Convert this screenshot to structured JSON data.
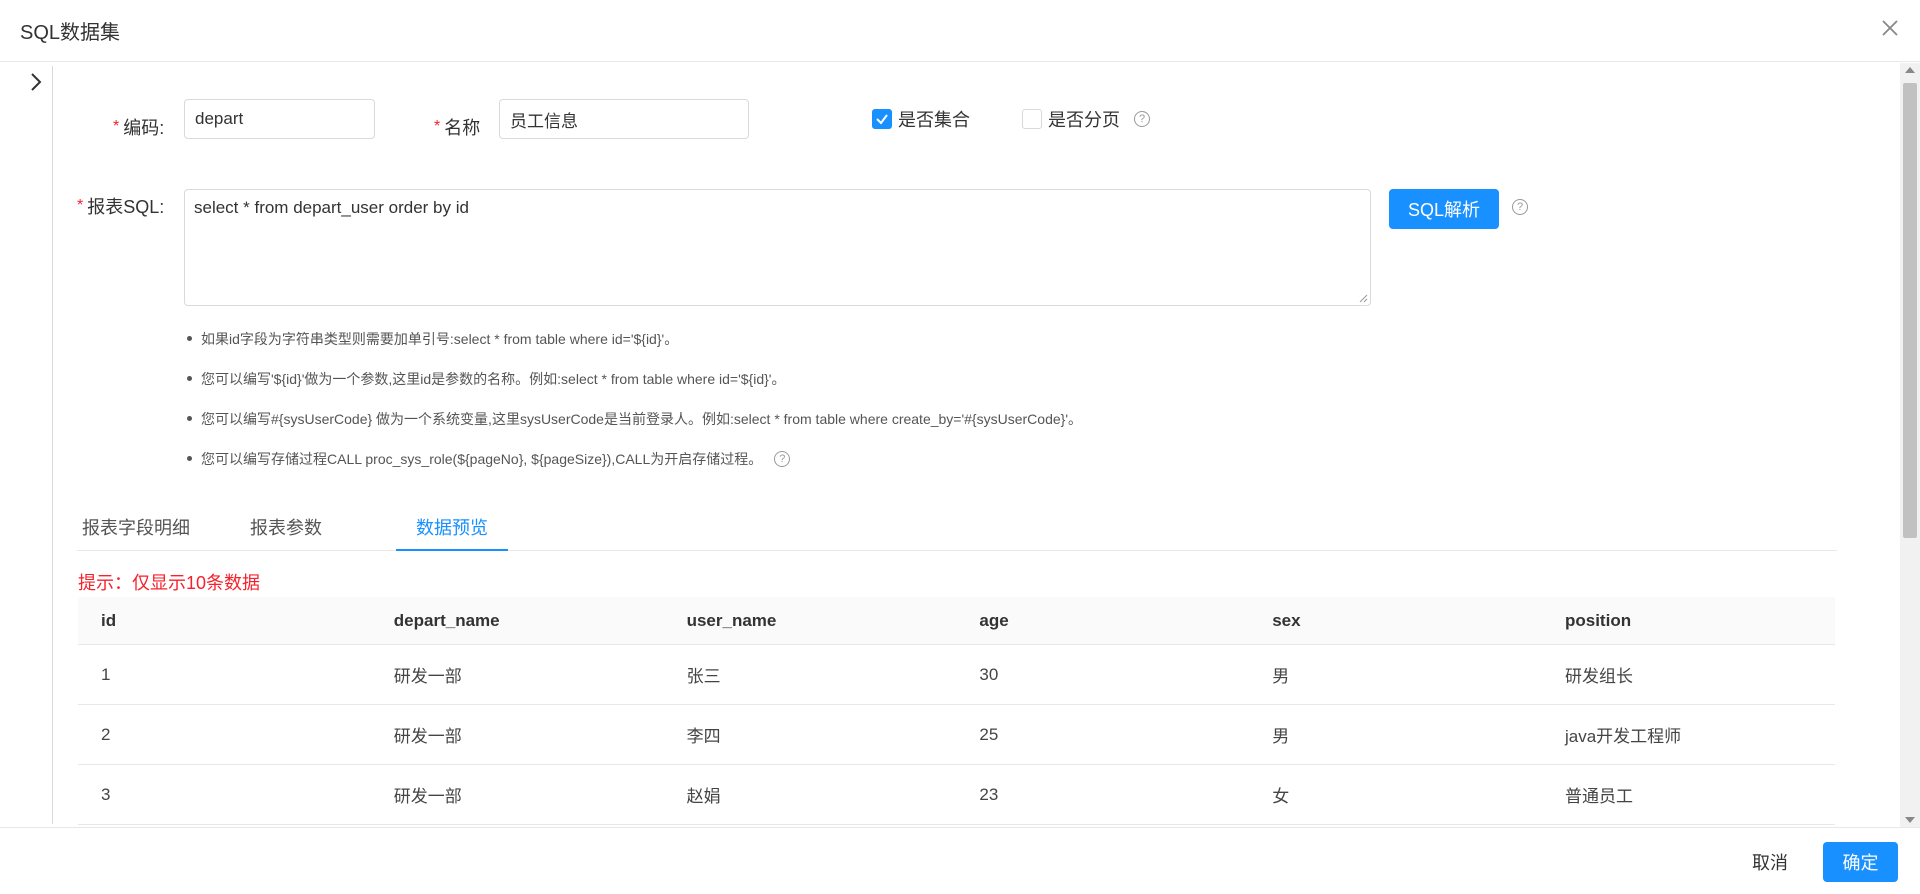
{
  "modal": {
    "title": "SQL数据集"
  },
  "form": {
    "code_label": "编码:",
    "code_value": "depart",
    "name_label": "名称",
    "name_value": "员工信息",
    "is_collection_label": "是否集合",
    "is_collection_checked": true,
    "is_paging_label": "是否分页",
    "is_paging_checked": false,
    "sql_label": "报表SQL:",
    "sql_value": "select *  from depart_user order by id",
    "parse_button": "SQL解析"
  },
  "tips": [
    "如果id字段为字符串类型则需要加单引号:select * from table where id='${id}'。",
    "您可以编写'${id}'做为一个参数,这里id是参数的名称。例如:select * from table where id='${id}'。",
    "您可以编写#{sysUserCode} 做为一个系统变量,这里sysUserCode是当前登录人。例如:select * from table where create_by='#{sysUserCode}'。",
    "您可以编写存储过程CALL proc_sys_role(${pageNo}, ${pageSize}),CALL为开启存储过程。"
  ],
  "tabs": [
    {
      "label": "报表字段明细"
    },
    {
      "label": "报表参数"
    },
    {
      "label": "数据预览"
    }
  ],
  "active_tab": "数据预览",
  "notice": "提示：仅显示10条数据",
  "table": {
    "columns": [
      "id",
      "depart_name",
      "user_name",
      "age",
      "sex",
      "position"
    ],
    "rows": [
      [
        "1",
        "研发一部",
        "张三",
        "30",
        "男",
        "研发组长"
      ],
      [
        "2",
        "研发一部",
        "李四",
        "25",
        "男",
        "java开发工程师"
      ],
      [
        "3",
        "研发一部",
        "赵娟",
        "23",
        "女",
        "普通员工"
      ]
    ]
  },
  "footer": {
    "cancel": "取消",
    "confirm": "确定"
  },
  "colors": {
    "primary": "#1890ff",
    "required": "#f5222d"
  },
  "icons": [
    "close-icon",
    "chevron-right-icon",
    "check-icon",
    "help-circle-icon"
  ]
}
